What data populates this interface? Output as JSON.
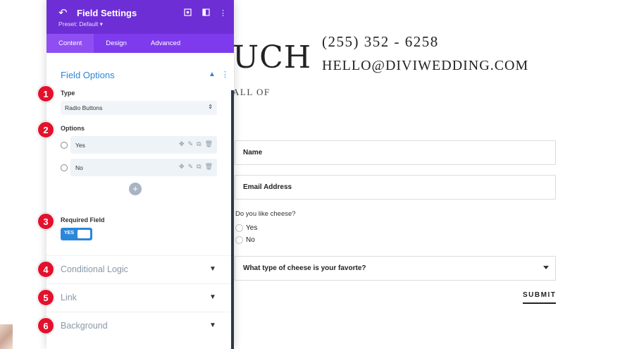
{
  "website": {
    "heading_fragment": "UCH",
    "sub_fragment": "ALL OF",
    "phone": "(255)  352 - 6258",
    "email": "HELLO@DIVIWEDDING.COM",
    "form": {
      "name_placeholder": "Name",
      "email_placeholder": "Email Address",
      "question": "Do you like cheese?",
      "radio_options": [
        "Yes",
        "No"
      ],
      "select_placeholder": "What type of cheese is your favorte?",
      "submit_label": "SUBMIT"
    }
  },
  "panel": {
    "title": "Field Settings",
    "preset": "Preset: Default ▾",
    "header_icons": [
      "back-icon",
      "target-icon",
      "sidebar-icon",
      "more-icon"
    ],
    "tabs": [
      {
        "label": "Content",
        "active": true
      },
      {
        "label": "Design",
        "active": false
      },
      {
        "label": "Advanced",
        "active": false
      }
    ],
    "field_options": {
      "title": "Field Options",
      "type_label": "Type",
      "type_value": "Radio Buttons",
      "options_label": "Options",
      "options": [
        "Yes",
        "No"
      ],
      "required_label": "Required Field",
      "required_value": "YES"
    },
    "sections": [
      "Conditional Logic",
      "Link",
      "Background"
    ]
  },
  "markers": [
    "1",
    "2",
    "3",
    "4",
    "5",
    "6"
  ],
  "colors": {
    "panel_header": "#6d2fd5",
    "panel_tabs": "#7e3bed",
    "accent_blue": "#2b87da",
    "marker_red": "#e3112c"
  }
}
